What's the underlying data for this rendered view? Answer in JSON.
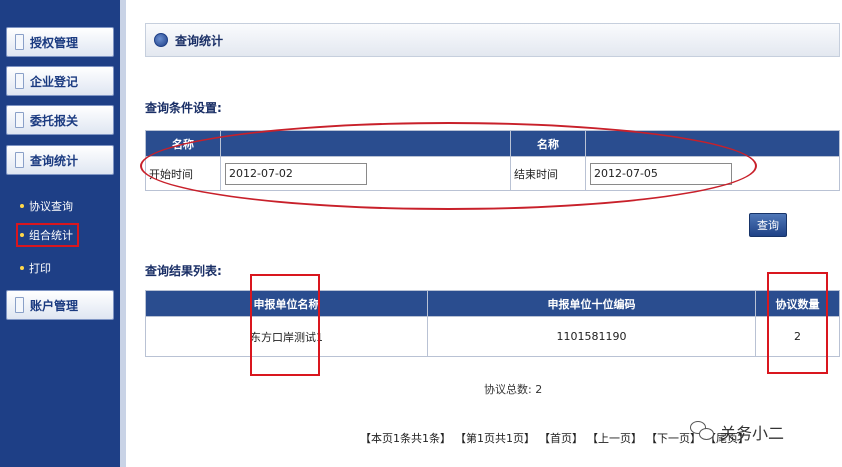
{
  "sidebar": {
    "items": [
      {
        "label": "授权管理"
      },
      {
        "label": "企业登记"
      },
      {
        "label": "委托报关"
      },
      {
        "label": "查询统计"
      }
    ],
    "sub_items": [
      {
        "label": "协议查询"
      },
      {
        "label": "组合统计"
      },
      {
        "label": "打印"
      }
    ],
    "last_item": {
      "label": "账户管理"
    }
  },
  "header": {
    "title": "查询统计"
  },
  "conditions": {
    "section_title": "查询条件设置:",
    "col_header_1": "名称",
    "col_header_2": "名称",
    "start_label": "开始时间",
    "start_value": "2012-07-02",
    "end_label": "结束时间",
    "end_value": "2012-07-05",
    "query_button": "查询"
  },
  "results": {
    "section_title": "查询结果列表:",
    "columns": [
      "申报单位名称",
      "申报单位十位编码",
      "协议数量"
    ],
    "rows": [
      [
        "东方口岸测试1",
        "1101581190",
        "2"
      ]
    ],
    "total_text": "协议总数: 2"
  },
  "pager": {
    "items": [
      "【本页1条共1条】",
      "【第1页共1页】",
      "【首页】",
      "【上一页】",
      "【下一页】",
      "【尾页】"
    ]
  },
  "watermark": {
    "text": "关务小二"
  },
  "colors": {
    "sidebar_bg": "#1e3f86",
    "table_header_bg": "#2a4d8f",
    "annotation_red": "#d9161e"
  }
}
